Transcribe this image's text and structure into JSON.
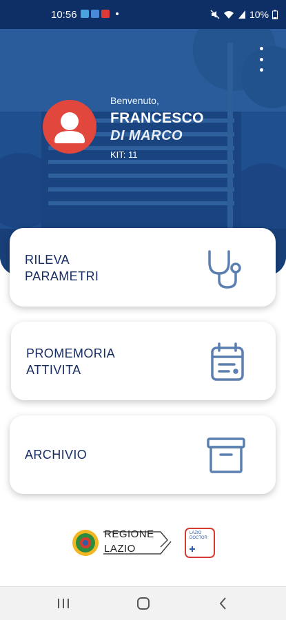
{
  "status_bar": {
    "time": "10:56",
    "battery": "10%"
  },
  "header": {
    "greeting": "Benvenuto,",
    "first_name": "FRANCESCO",
    "last_name": "DI MARCO",
    "kit": "KIT: 11"
  },
  "cards": [
    {
      "line1": "RILEVA",
      "line2": "PARAMETRI",
      "icon": "stethoscope-icon"
    },
    {
      "line1": "PROMEMORIA",
      "line2": "ATTIVITA",
      "icon": "calendar-icon"
    },
    {
      "line1": "ARCHIVIO",
      "line2": "",
      "icon": "archive-box-icon"
    }
  ],
  "footer": {
    "region_line1": "REGIONE",
    "region_line2": "LAZIO",
    "doctor_line1": "LAZIO",
    "doctor_line2": "DOCTOR"
  },
  "colors": {
    "primary_dark": "#0d2f66",
    "header_blue": "#1e4f8f",
    "avatar_red": "#e2473d",
    "text_navy": "#172d63",
    "icon_blue": "#5b7fb0"
  }
}
